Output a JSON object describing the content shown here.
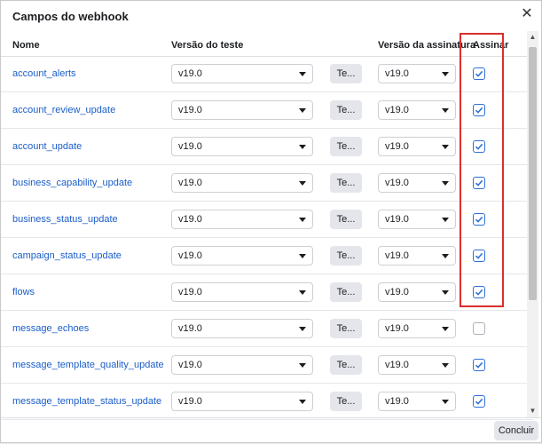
{
  "dialog": {
    "title": "Campos do webhook",
    "close_glyph": "✕",
    "done_label": "Concluir"
  },
  "columns": {
    "name": "Nome",
    "test_version": "Versão do teste",
    "signature_version": "Versão da assinatura",
    "subscribe": "Assinar"
  },
  "rows": [
    {
      "name": "account_alerts",
      "test_version": "v19.0",
      "test_button": "Te...",
      "signature_version": "v19.0",
      "subscribed": true
    },
    {
      "name": "account_review_update",
      "test_version": "v19.0",
      "test_button": "Te...",
      "signature_version": "v19.0",
      "subscribed": true
    },
    {
      "name": "account_update",
      "test_version": "v19.0",
      "test_button": "Te...",
      "signature_version": "v19.0",
      "subscribed": true
    },
    {
      "name": "business_capability_update",
      "test_version": "v19.0",
      "test_button": "Te...",
      "signature_version": "v19.0",
      "subscribed": true
    },
    {
      "name": "business_status_update",
      "test_version": "v19.0",
      "test_button": "Te...",
      "signature_version": "v19.0",
      "subscribed": true
    },
    {
      "name": "campaign_status_update",
      "test_version": "v19.0",
      "test_button": "Te...",
      "signature_version": "v19.0",
      "subscribed": true
    },
    {
      "name": "flows",
      "test_version": "v19.0",
      "test_button": "Te...",
      "signature_version": "v19.0",
      "subscribed": true
    },
    {
      "name": "message_echoes",
      "test_version": "v19.0",
      "test_button": "Te...",
      "signature_version": "v19.0",
      "subscribed": false
    },
    {
      "name": "message_template_quality_update",
      "test_version": "v19.0",
      "test_button": "Te...",
      "signature_version": "v19.0",
      "subscribed": true
    },
    {
      "name": "message_template_status_update",
      "test_version": "v19.0",
      "test_button": "Te...",
      "signature_version": "v19.0",
      "subscribed": true
    }
  ],
  "colors": {
    "link": "#1a5dc8",
    "highlight": "#d9302c",
    "check": "#2e6fd8"
  }
}
